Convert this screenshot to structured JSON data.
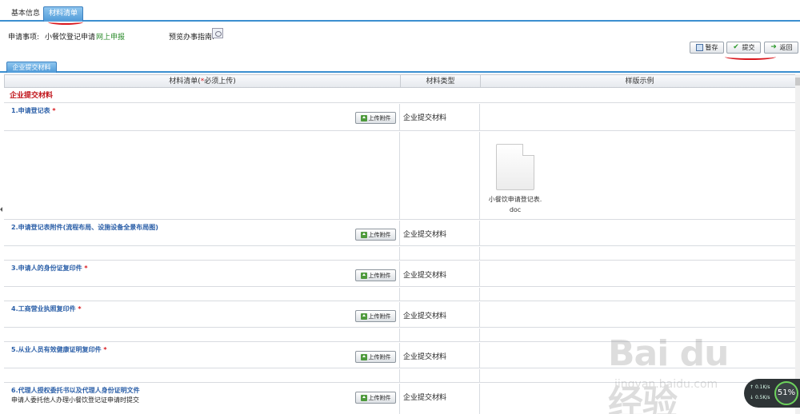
{
  "tabs": [
    {
      "label": "基本信息",
      "active": false
    },
    {
      "label": "材料清单",
      "active": true
    }
  ],
  "info": {
    "matter_label": "申请事项:",
    "matter_value": "小餐饮登记申请",
    "apply_mode": "网上申报",
    "guide_label": "预览办事指南:"
  },
  "actions": {
    "save": "暂存",
    "submit": "提交",
    "back": "返回"
  },
  "sub_tab": "企业提交材料",
  "table": {
    "headers": {
      "list_prefix": "材料清单(",
      "list_star": "*",
      "list_suffix": "必须上传)",
      "type": "材料类型",
      "sample": "样版示例"
    },
    "section": "企业提交材料",
    "upload_label": "上传附件",
    "items": [
      {
        "title": "1.申请登记表",
        "required": "*",
        "note": "",
        "type": "企业提交材料"
      },
      {
        "title": "2.申请登记表附件(流程布局、设施设备全景布局图)",
        "required": "",
        "note": "",
        "type": "企业提交材料"
      },
      {
        "title": "3.申请人的身份证复印件",
        "required": "*",
        "note": "",
        "type": "企业提交材料"
      },
      {
        "title": "4.工商营业执照复印件",
        "required": "*",
        "note": "",
        "type": "企业提交材料"
      },
      {
        "title": "5.从业人员有效健康证明复印件",
        "required": "*",
        "note": "",
        "type": "企业提交材料"
      },
      {
        "title": "6.代理人授权委托书以及代理人身份证明文件",
        "required": "",
        "note": "申请人委托他人办理小餐饮登记证申请时提交",
        "type": "企业提交材料"
      }
    ],
    "sample_file": {
      "name_line1": "小餐饮申请登记表.",
      "name_line2": "doc"
    }
  },
  "watermark": {
    "brand": "Bai du 经验",
    "url": "jingyan.baidu.com"
  },
  "network": {
    "up": "0.1K/s",
    "down": "0.5K/s",
    "percent": "51%"
  },
  "colors": {
    "accent": "#3b8fd0",
    "section_red": "#c0141a",
    "item_blue": "#2b5fa8",
    "green": "#2a8a2a"
  }
}
